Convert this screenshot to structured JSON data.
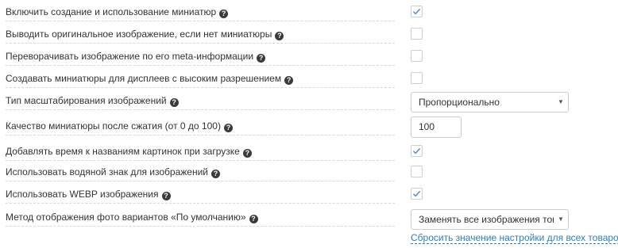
{
  "settings": {
    "rows": [
      {
        "label": "Включить создание и использование миниатюр",
        "control": "checkbox",
        "checked": true
      },
      {
        "label": "Выводить оригинальное изображение, если нет миниатюры",
        "control": "checkbox",
        "checked": false
      },
      {
        "label": "Переворачивать изображение по его meta-информации",
        "control": "checkbox",
        "checked": false
      },
      {
        "label": "Создавать миниатюры для дисплеев с высоким разрешением",
        "control": "checkbox",
        "checked": false
      },
      {
        "label": "Тип масштабирования изображений",
        "control": "select",
        "value": "Пропорционально"
      },
      {
        "label": "Качество миниатюры после сжатия (от 0 до 100)",
        "control": "number",
        "value": "100"
      },
      {
        "label": "Добавлять время к названиям картинок при загрузке",
        "control": "checkbox",
        "checked": true
      },
      {
        "label": "Использовать водяной знак для изображений",
        "control": "checkbox",
        "checked": false
      },
      {
        "label": "Использовать WEBP изображения",
        "control": "checkbox",
        "checked": true
      },
      {
        "label": "Метод отображения фото вариантов «По умолчанию»",
        "control": "select",
        "value": "Заменять все изображения товара"
      }
    ],
    "reset_link": "Сбросить значение настройки для всех товаров"
  },
  "icons": {
    "help": "help-circle-icon",
    "check": "checkmark-icon",
    "dropdown": "chevron-down-icon"
  },
  "colors": {
    "check": "#5b8fd6",
    "link": "#2b7fc1",
    "help_bg": "#3a3a3a"
  }
}
